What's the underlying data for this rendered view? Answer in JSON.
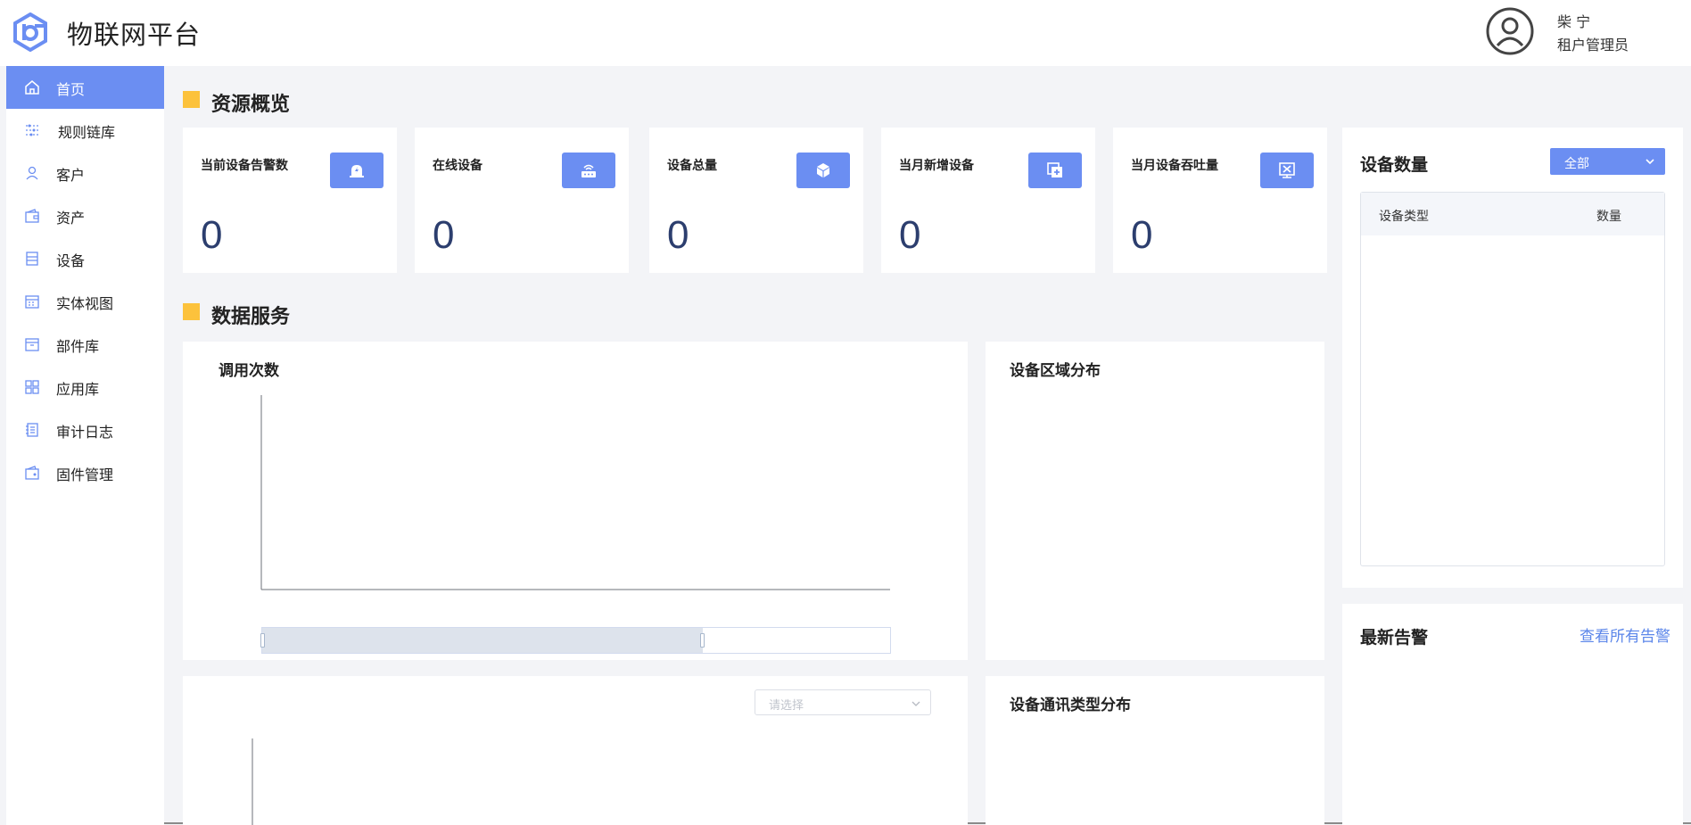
{
  "header": {
    "app_title": "物联网平台",
    "user_name": "柴 宁",
    "user_role": "租户管理员"
  },
  "sidebar": {
    "items": [
      {
        "label": "首页",
        "icon": "home-icon",
        "active": true
      },
      {
        "label": "规则链库",
        "icon": "rules-icon",
        "active": false
      },
      {
        "label": "客户",
        "icon": "user-icon",
        "active": false
      },
      {
        "label": "资产",
        "icon": "wallet-icon",
        "active": false
      },
      {
        "label": "设备",
        "icon": "server-icon",
        "active": false
      },
      {
        "label": "实体视图",
        "icon": "calendar-icon",
        "active": false
      },
      {
        "label": "部件库",
        "icon": "box-icon",
        "active": false
      },
      {
        "label": "应用库",
        "icon": "grid-icon",
        "active": false
      },
      {
        "label": "审计日志",
        "icon": "log-icon",
        "active": false
      },
      {
        "label": "固件管理",
        "icon": "firmware-icon",
        "active": false
      }
    ]
  },
  "overview": {
    "title": "资源概览",
    "cards": [
      {
        "label": "当前设备告警数",
        "value": "0",
        "icon": "alarm-icon"
      },
      {
        "label": "在线设备",
        "value": "0",
        "icon": "router-icon"
      },
      {
        "label": "设备总量",
        "value": "0",
        "icon": "cube-icon"
      },
      {
        "label": "当月新增设备",
        "value": "0",
        "icon": "add-copy-icon"
      },
      {
        "label": "当月设备吞吐量",
        "value": "0",
        "icon": "monitor-close-icon"
      }
    ]
  },
  "device_count": {
    "title": "设备数量",
    "filter_value": "全部",
    "columns": [
      "设备类型",
      "数量"
    ]
  },
  "data_services": {
    "title": "数据服务",
    "calls_title": "调用次数",
    "region_title": "设备区域分布",
    "comm_title": "设备通讯类型分布",
    "select_placeholder": "请选择"
  },
  "alarms": {
    "title": "最新告警",
    "view_all": "查看所有告警"
  },
  "colors": {
    "accent": "#6b8ef2",
    "section_mark": "#fcc23c",
    "value_text": "#2c3e6e",
    "link": "#5b86ea"
  }
}
